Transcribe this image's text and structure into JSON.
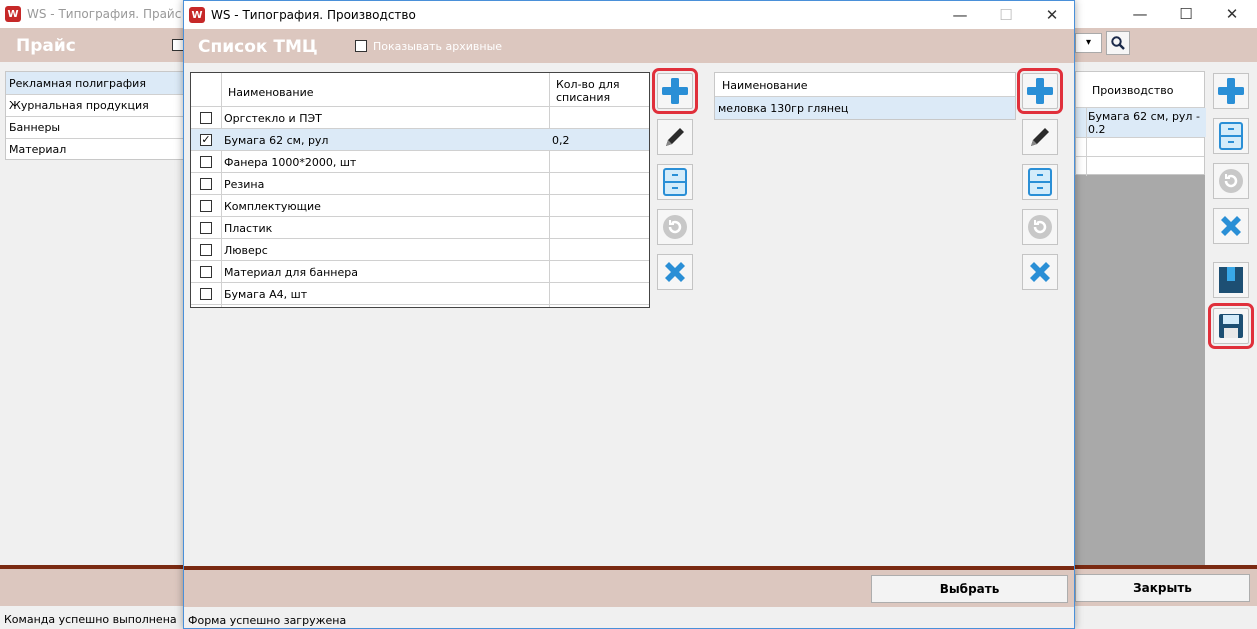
{
  "back_window": {
    "title": "WS - Типография. Прайс",
    "header_title": "Прайс",
    "category_list": [
      "Рекламная полиграфия",
      "Журнальная продукция",
      "Баннеры",
      "Материал"
    ],
    "right_table": {
      "header": "Производство",
      "rows": [
        "Бумага 62 см, рул - 0.2",
        "",
        ""
      ]
    },
    "close_button": "Закрыть",
    "status": "Команда успешно выполнена"
  },
  "front_window": {
    "title": "WS - Типография. Производство",
    "header_title": "Список ТМЦ",
    "show_archived_label": "Показывать архивные",
    "materials_table": {
      "col_name": "Наименование",
      "col_qty": "Кол-во для списания",
      "rows": [
        {
          "name": "Оргстекло и ПЭТ",
          "qty": "",
          "checked": false
        },
        {
          "name": "Бумага 62 см, рул",
          "qty": "0,2",
          "checked": true
        },
        {
          "name": "Фанера 1000*2000, шт",
          "qty": "",
          "checked": false
        },
        {
          "name": "Резина",
          "qty": "",
          "checked": false
        },
        {
          "name": "Комплектующие",
          "qty": "",
          "checked": false
        },
        {
          "name": "Пластик",
          "qty": "",
          "checked": false
        },
        {
          "name": "Люверс",
          "qty": "",
          "checked": false
        },
        {
          "name": "Материал для баннера",
          "qty": "",
          "checked": false
        },
        {
          "name": "Бумага А4, шт",
          "qty": "",
          "checked": false
        }
      ]
    },
    "second_table": {
      "col_name": "Наименование",
      "rows": [
        "меловка 130гр глянец"
      ]
    },
    "select_button": "Выбрать",
    "status": "Форма успешно загружена"
  },
  "colors": {
    "accent_header": "#dcc7bf",
    "highlight": "#e0303b",
    "selected_row": "#dceaf7",
    "brown_line": "#7a2a12"
  }
}
